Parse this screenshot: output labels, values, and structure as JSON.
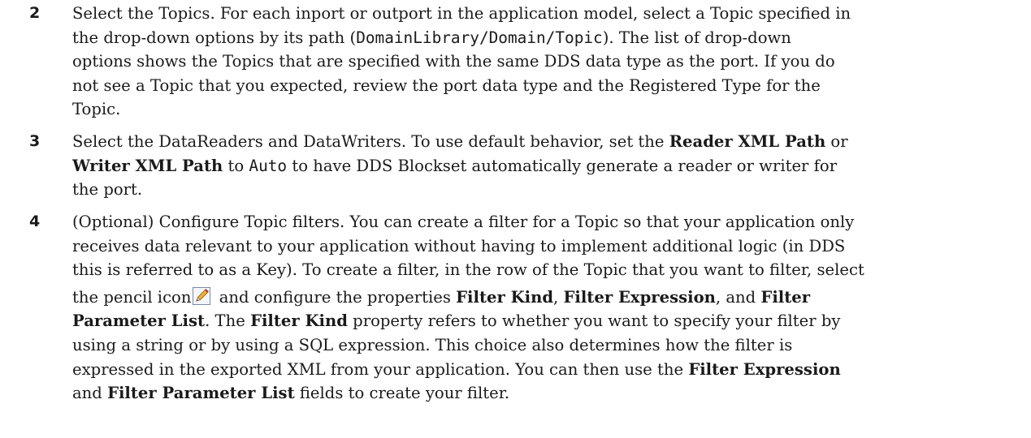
{
  "steps": [
    {
      "number": "2",
      "lines": [
        [
          "Select the Topics. For each inport or outport in the application model, select a Topic specified in"
        ],
        [
          "the drop-down options by its path (",
          "DomainLibrary/Domain/Topic",
          "). The list of drop-down"
        ],
        [
          "options shows the Topics that are specified with the same DDS data type as the port. If you do"
        ],
        [
          "not see a Topic that you expected, review the port data type and the Registered Type for the"
        ],
        [
          "Topic."
        ]
      ]
    },
    {
      "number": "3",
      "lines": [
        [
          "Select the DataReaders and DataWriters. To use default behavior, set the ",
          "Reader XML Path",
          " or"
        ],
        [
          "Writer XML Path",
          " to ",
          "Auto",
          " to have DDS Blockset automatically generate a reader or writer for"
        ],
        [
          "the port."
        ]
      ]
    },
    {
      "number": "4",
      "lines": [
        [
          "(Optional) Configure Topic filters. You can create a filter for a Topic so that your application only"
        ],
        [
          "receives data relevant to your application without having to implement additional logic (in DDS"
        ],
        [
          "this is referred to as a Key). To create a filter, in the row of the Topic that you want to filter, select"
        ],
        [
          "the pencil icon",
          " and configure the properties ",
          "Filter Kind",
          ", ",
          "Filter Expression",
          ", and ",
          "Filter"
        ],
        [
          "Parameter List",
          ". The ",
          "Filter Kind",
          " property refers to whether you want to specify your filter by"
        ],
        [
          "using a string or by using a SQL expression. This choice also determines how the filter is"
        ],
        [
          "expressed in the exported XML from your application. You can then use the ",
          "Filter Expression"
        ],
        [
          "and ",
          "Filter Parameter List",
          " fields to create your filter."
        ]
      ]
    }
  ]
}
